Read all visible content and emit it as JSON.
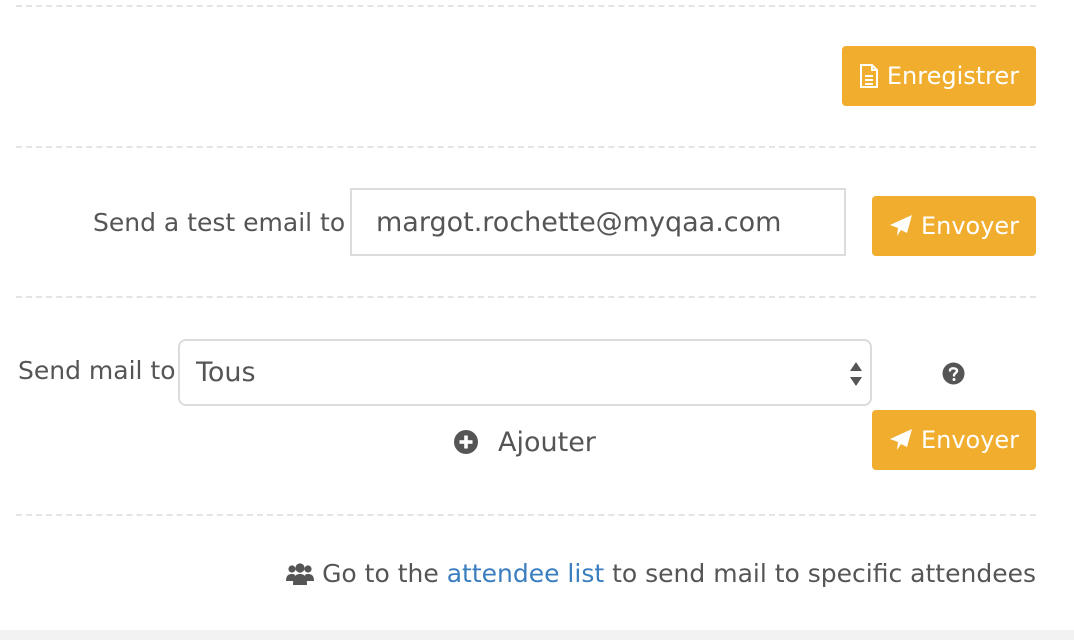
{
  "toolbar": {
    "save_label": "Enregistrer"
  },
  "test_email": {
    "label": "Send a test email to",
    "value": "margot.rochette@myqaa.com",
    "send_label": "Envoyer"
  },
  "send_mail": {
    "label": "Send mail to",
    "selected": "Tous",
    "add_label": "Ajouter",
    "send_label": "Envoyer"
  },
  "footer": {
    "prefix": "Go to the",
    "link": "attendee list",
    "suffix": "to send mail to specific attendees"
  },
  "icons": {
    "save": "document-icon",
    "send": "paper-plane-icon",
    "help": "question-circle-icon",
    "add": "plus-circle-icon",
    "users": "users-icon"
  },
  "colors": {
    "accent": "#f0ad2e",
    "link": "#3a7ebf",
    "text": "#555555"
  }
}
